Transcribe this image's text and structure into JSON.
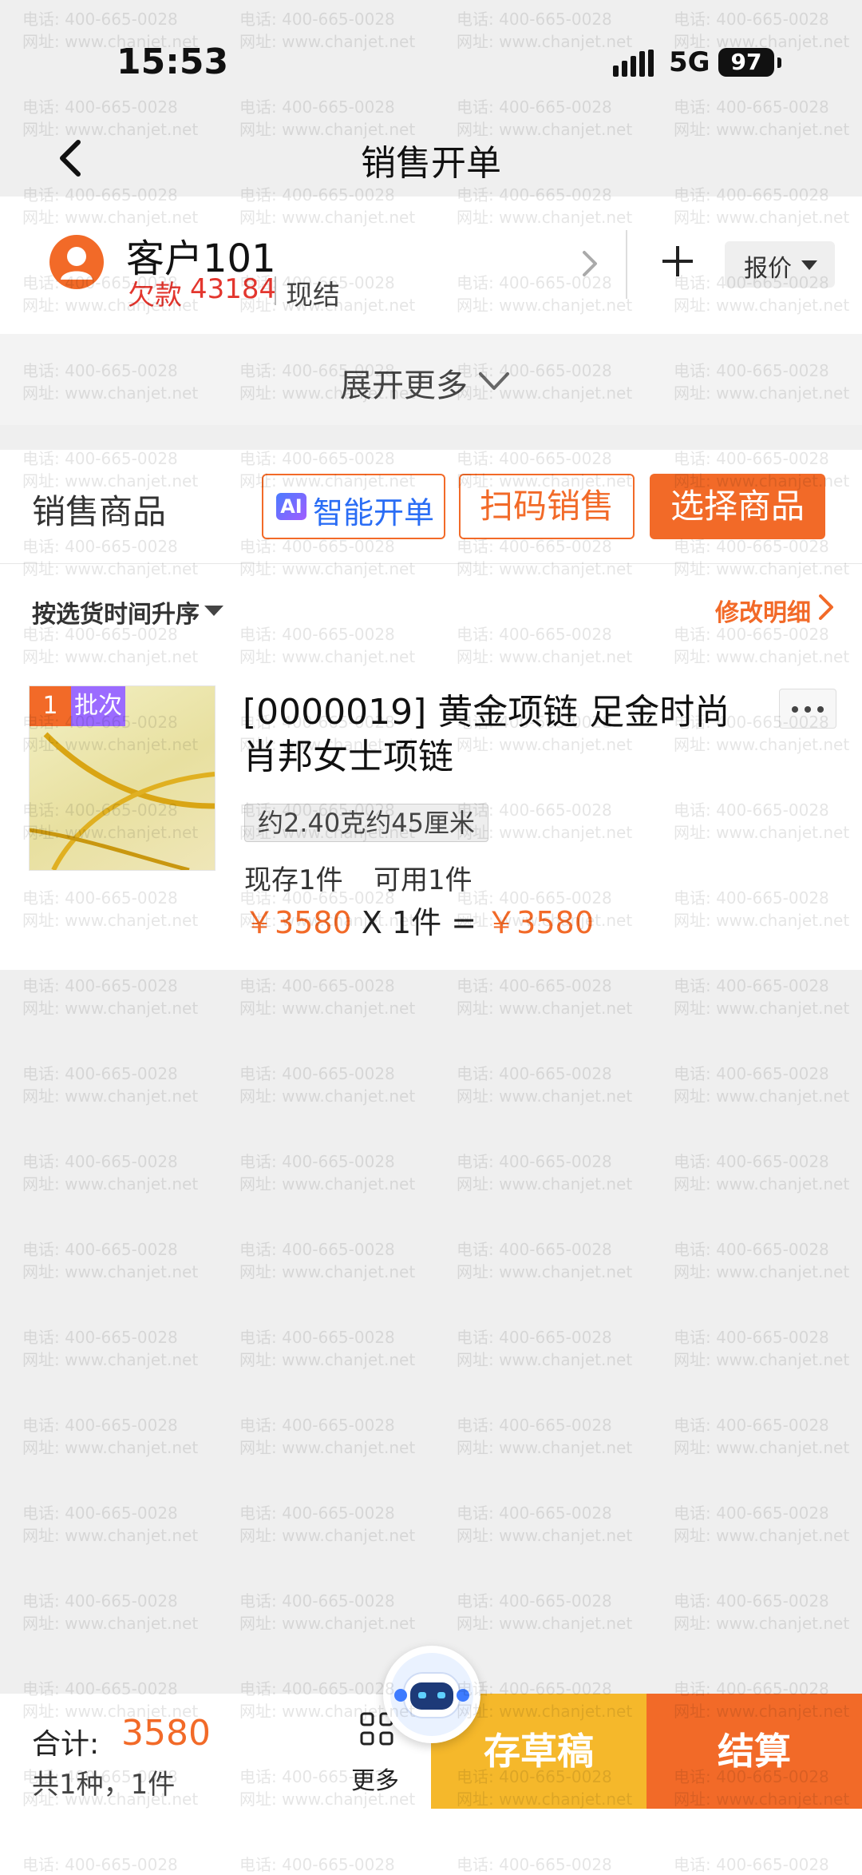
{
  "status_bar": {
    "time": "15:53",
    "network": "5G",
    "battery": "97"
  },
  "nav": {
    "title": "销售开单"
  },
  "customer": {
    "name": "客户101",
    "debt_label": "欠款",
    "debt_value": "43184",
    "settlement": "现结",
    "quote_label": "报价"
  },
  "expand": {
    "label": "展开更多"
  },
  "section": {
    "title": "销售商品",
    "ai_badge": "AI",
    "ai_label": "智能开单",
    "scan_label": "扫码销售",
    "choose_label": "选择商品"
  },
  "sort": {
    "label": "按选货时间升序",
    "edit_label": "修改明细"
  },
  "products": [
    {
      "index": "1",
      "batch": "批次",
      "name": "[0000019] 黄金项链 足金时尚肖邦女士项链",
      "spec": "约2.40克约45厘米",
      "stock": "现存1件",
      "available": "可用1件",
      "unit_price": "￥3580",
      "times": "X",
      "qty": "1件",
      "equals": "=",
      "subtotal": "￥3580"
    }
  ],
  "bottom": {
    "total_label": "合计:",
    "total_value": "3580",
    "count": "共1种，1件",
    "more_label": "更多",
    "draft_label": "存草稿",
    "settle_label": "结算"
  },
  "watermark": {
    "line1": "电话: 400-665-0028",
    "line2": "网址: www.chanjet.net"
  },
  "colors": {
    "accent": "#f26a28",
    "draft": "#f5b82b",
    "debt": "#e3362e",
    "ai": "#2a6df5"
  }
}
